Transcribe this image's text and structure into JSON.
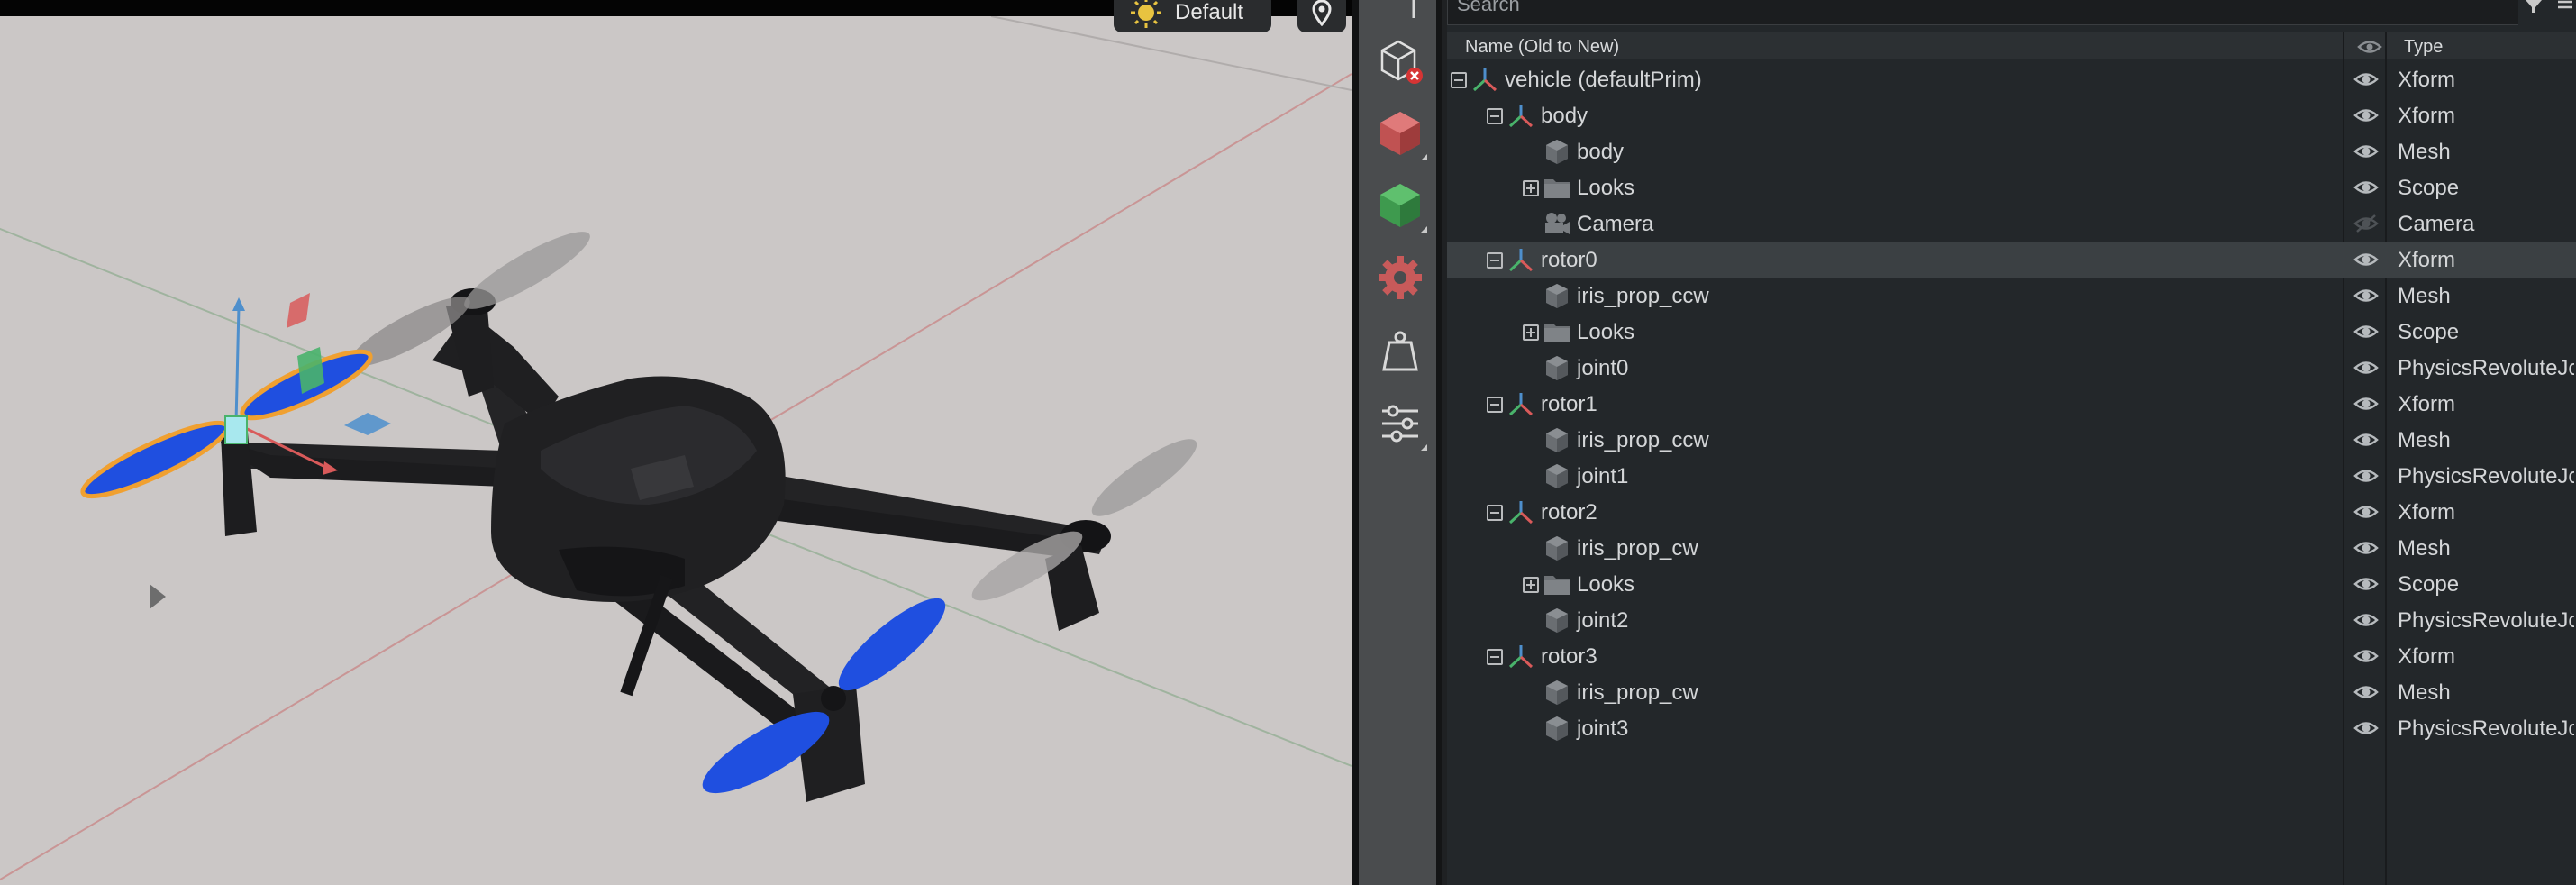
{
  "viewport": {
    "render_mode": "Default",
    "render_mode_icon": "sun-icon",
    "camera_pin_icon": "location-pin-icon"
  },
  "toolbar": {
    "tools": [
      {
        "icon": "cube-delete-icon",
        "label": "remove-prim"
      },
      {
        "icon": "cube-red-icon",
        "label": "create-shape"
      },
      {
        "icon": "cube-green-icon",
        "label": "create-mesh"
      },
      {
        "icon": "gear-red-icon",
        "label": "physics-settings"
      },
      {
        "icon": "weight-icon",
        "label": "mass"
      },
      {
        "icon": "sliders-icon",
        "label": "settings"
      }
    ]
  },
  "stage": {
    "search_placeholder": "Search",
    "header": {
      "name": "Name (Old to New)",
      "type": "Type"
    },
    "rows": [
      {
        "label": "vehicle (defaultPrim)",
        "type": "Xform",
        "icon": "xform-axes-icon",
        "toggle": "minus",
        "depth": 0,
        "visible": true
      },
      {
        "label": "body",
        "type": "Xform",
        "icon": "xform-axes-icon",
        "toggle": "minus",
        "depth": 1,
        "visible": true
      },
      {
        "label": "body",
        "type": "Mesh",
        "icon": "mesh-cube-icon",
        "toggle": "none",
        "depth": 2,
        "visible": true
      },
      {
        "label": "Looks",
        "type": "Scope",
        "icon": "folder-icon",
        "toggle": "plus",
        "depth": 2,
        "visible": true
      },
      {
        "label": "Camera",
        "type": "Camera",
        "icon": "camera-icon",
        "toggle": "none",
        "depth": 2,
        "visible": false
      },
      {
        "label": "rotor0",
        "type": "Xform",
        "icon": "xform-axes-icon",
        "toggle": "minus",
        "depth": 1,
        "visible": true,
        "selected": true
      },
      {
        "label": "iris_prop_ccw",
        "type": "Mesh",
        "icon": "mesh-cube-icon",
        "toggle": "none",
        "depth": 2,
        "visible": true
      },
      {
        "label": "Looks",
        "type": "Scope",
        "icon": "folder-icon",
        "toggle": "plus",
        "depth": 2,
        "visible": true
      },
      {
        "label": "joint0",
        "type": "PhysicsRevoluteJoint",
        "icon": "mesh-cube-icon",
        "toggle": "none",
        "depth": 2,
        "visible": true
      },
      {
        "label": "rotor1",
        "type": "Xform",
        "icon": "xform-axes-icon",
        "toggle": "minus",
        "depth": 1,
        "visible": true
      },
      {
        "label": "iris_prop_ccw",
        "type": "Mesh",
        "icon": "mesh-cube-icon",
        "toggle": "none",
        "depth": 2,
        "visible": true
      },
      {
        "label": "joint1",
        "type": "PhysicsRevoluteJoint",
        "icon": "mesh-cube-icon",
        "toggle": "none",
        "depth": 2,
        "visible": true
      },
      {
        "label": "rotor2",
        "type": "Xform",
        "icon": "xform-axes-icon",
        "toggle": "minus",
        "depth": 1,
        "visible": true
      },
      {
        "label": "iris_prop_cw",
        "type": "Mesh",
        "icon": "mesh-cube-icon",
        "toggle": "none",
        "depth": 2,
        "visible": true
      },
      {
        "label": "Looks",
        "type": "Scope",
        "icon": "folder-icon",
        "toggle": "plus",
        "depth": 2,
        "visible": true
      },
      {
        "label": "joint2",
        "type": "PhysicsRevoluteJoint",
        "icon": "mesh-cube-icon",
        "toggle": "none",
        "depth": 2,
        "visible": true
      },
      {
        "label": "rotor3",
        "type": "Xform",
        "icon": "xform-axes-icon",
        "toggle": "minus",
        "depth": 1,
        "visible": true
      },
      {
        "label": "iris_prop_cw",
        "type": "Mesh",
        "icon": "mesh-cube-icon",
        "toggle": "none",
        "depth": 2,
        "visible": true
      },
      {
        "label": "joint3",
        "type": "PhysicsRevoluteJoint",
        "icon": "mesh-cube-icon",
        "toggle": "none",
        "depth": 2,
        "visible": true
      }
    ]
  },
  "colors": {
    "viewport_bg": "#cbc7c6",
    "panel_bg": "#23272a",
    "selected_row": "#3b4043",
    "selection_blue": "#1f4fe0",
    "selection_outline": "#f0a030",
    "gizmo_x": "#d95a5a",
    "gizmo_y": "#4e8fcc",
    "gizmo_z": "#49b36b"
  }
}
